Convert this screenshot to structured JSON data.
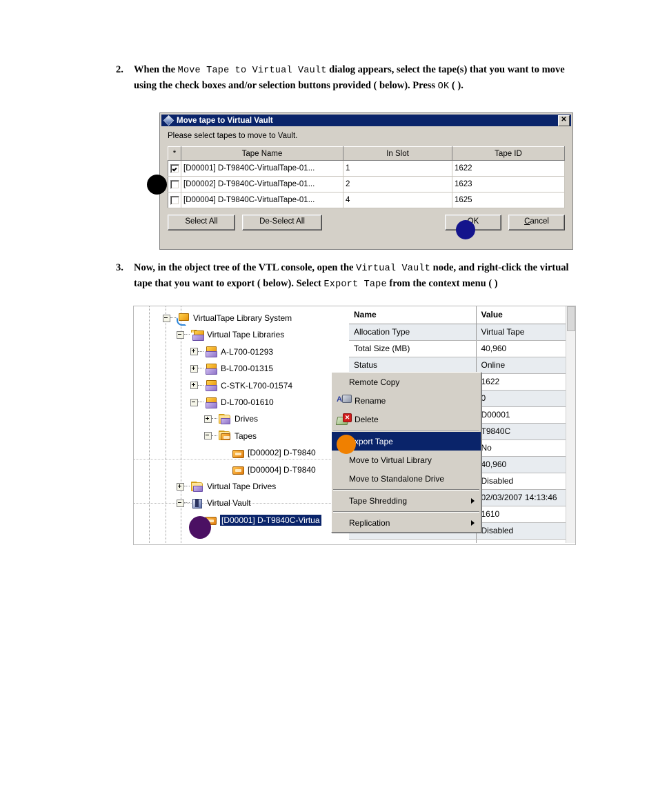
{
  "steps": [
    {
      "number": "2.",
      "segments": [
        {
          "t": "When the ",
          "mono": false
        },
        {
          "t": "Move Tape to Virtual Vault",
          "mono": true
        },
        {
          "t": " dialog appears, select the tape(s) that you want to move using the check boxes and/or selection buttons provided (   below). Press ",
          "mono": false
        },
        {
          "t": "OK",
          "mono": true
        },
        {
          "t": " (   ).",
          "mono": false
        }
      ]
    },
    {
      "number": "3.",
      "segments": [
        {
          "t": "Now, in the object tree of the VTL console, open the ",
          "mono": false
        },
        {
          "t": "Virtual Vault",
          "mono": true
        },
        {
          "t": " node, and right-click the virtual tape that you want to export (   below). Select ",
          "mono": false
        },
        {
          "t": "Export Tape",
          "mono": true
        },
        {
          "t": " from the context menu (  )",
          "mono": false
        }
      ]
    }
  ],
  "dialog": {
    "title": "Move tape to Virtual Vault",
    "close_label": "✕",
    "prompt": "Please select tapes to move to Vault.",
    "columns": [
      "*",
      "Tape Name",
      "In Slot",
      "Tape ID"
    ],
    "rows": [
      {
        "checked": true,
        "tape_name": "[D00001] D-T9840C-VirtualTape-01...",
        "in_slot": "1",
        "tape_id": "1622"
      },
      {
        "checked": false,
        "tape_name": "[D00002] D-T9840C-VirtualTape-01...",
        "in_slot": "2",
        "tape_id": "1623"
      },
      {
        "checked": false,
        "tape_name": "[D00004] D-T9840C-VirtualTape-01...",
        "in_slot": "4",
        "tape_id": "1625"
      }
    ],
    "buttons": {
      "select_all": "Select All",
      "deselect_all": "De-Select All",
      "ok": "OK",
      "cancel": "Cancel"
    }
  },
  "markers": {
    "black_circle_color": "#000000",
    "blue_circle_color": "#14148c",
    "orange_circle_color": "#f08000",
    "purple_circle_color": "#4b1063"
  },
  "console": {
    "tree": [
      {
        "label": "VirtualTape Library System",
        "indent": 0,
        "expander": "minus",
        "icon": "library-system-icon",
        "selected": false
      },
      {
        "label": "Virtual Tape Libraries",
        "indent": 1,
        "expander": "minus",
        "icon": "folder-library-icon",
        "selected": false
      },
      {
        "label": "A-L700-01293",
        "indent": 2,
        "expander": "plus",
        "icon": "library-icon",
        "selected": false
      },
      {
        "label": "B-L700-01315",
        "indent": 2,
        "expander": "plus",
        "icon": "library-icon",
        "selected": false
      },
      {
        "label": "C-STK-L700-01574",
        "indent": 2,
        "expander": "plus",
        "icon": "library-icon",
        "selected": false
      },
      {
        "label": "D-L700-01610",
        "indent": 2,
        "expander": "minus",
        "icon": "library-icon",
        "selected": false
      },
      {
        "label": "Drives",
        "indent": 3,
        "expander": "plus",
        "icon": "folder-drives-icon",
        "selected": false
      },
      {
        "label": "Tapes",
        "indent": 3,
        "expander": "minus",
        "icon": "folder-tapes-icon",
        "selected": false
      },
      {
        "label": "[D00002] D-T9840",
        "indent": 4,
        "expander": "none",
        "icon": "tape-icon",
        "selected": false
      },
      {
        "label": "[D00004] D-T9840",
        "indent": 4,
        "expander": "none",
        "icon": "tape-icon",
        "selected": false
      },
      {
        "label": "Virtual Tape Drives",
        "indent": 1,
        "expander": "plus",
        "icon": "folder-drives-icon",
        "selected": false
      },
      {
        "label": "Virtual Vault",
        "indent": 1,
        "expander": "minus",
        "icon": "vault-icon",
        "selected": false
      },
      {
        "label": "[D00001] D-T9840C-Virtua",
        "indent": 2,
        "expander": "none",
        "icon": "tape-icon",
        "selected": true
      }
    ],
    "context_menu": [
      {
        "label": "Remote Copy",
        "icon": "none",
        "highlighted": false,
        "submenu": false,
        "separator_after": false
      },
      {
        "label": "Rename",
        "icon": "rename-icon",
        "highlighted": false,
        "submenu": false,
        "separator_after": false
      },
      {
        "label": "Delete",
        "icon": "delete-icon",
        "highlighted": false,
        "submenu": false,
        "separator_after": true
      },
      {
        "label": "Export Tape",
        "icon": "none",
        "highlighted": true,
        "submenu": false,
        "separator_after": false
      },
      {
        "label": "Move to Virtual Library",
        "icon": "none",
        "highlighted": false,
        "submenu": false,
        "separator_after": false
      },
      {
        "label": "Move to Standalone Drive",
        "icon": "none",
        "highlighted": false,
        "submenu": false,
        "separator_after": true
      },
      {
        "label": "Tape Shredding",
        "icon": "none",
        "highlighted": false,
        "submenu": true,
        "separator_after": true
      },
      {
        "label": "Replication",
        "icon": "none",
        "highlighted": false,
        "submenu": true,
        "separator_after": false
      }
    ],
    "properties": {
      "headers": [
        "Name",
        "Value"
      ],
      "rows": [
        {
          "name": "Allocation Type",
          "value": "Virtual Tape"
        },
        {
          "name": "Total Size (MB)",
          "value": "40,960"
        },
        {
          "name": "Status",
          "value": "Online"
        },
        {
          "name": "",
          "value": "1622"
        },
        {
          "name": "",
          "value": "0"
        },
        {
          "name": "",
          "value": "D00001"
        },
        {
          "name": "",
          "value": "T9840C"
        },
        {
          "name": "",
          "value": "No"
        },
        {
          "name": "",
          "value": "40,960"
        },
        {
          "name": "",
          "value": "Disabled"
        },
        {
          "name": "",
          "value": "02/03/2007 14:13:46"
        },
        {
          "name": "",
          "value": "1610"
        },
        {
          "name": "",
          "value": "Disabled"
        },
        {
          "name": "",
          "value": ""
        }
      ]
    }
  }
}
